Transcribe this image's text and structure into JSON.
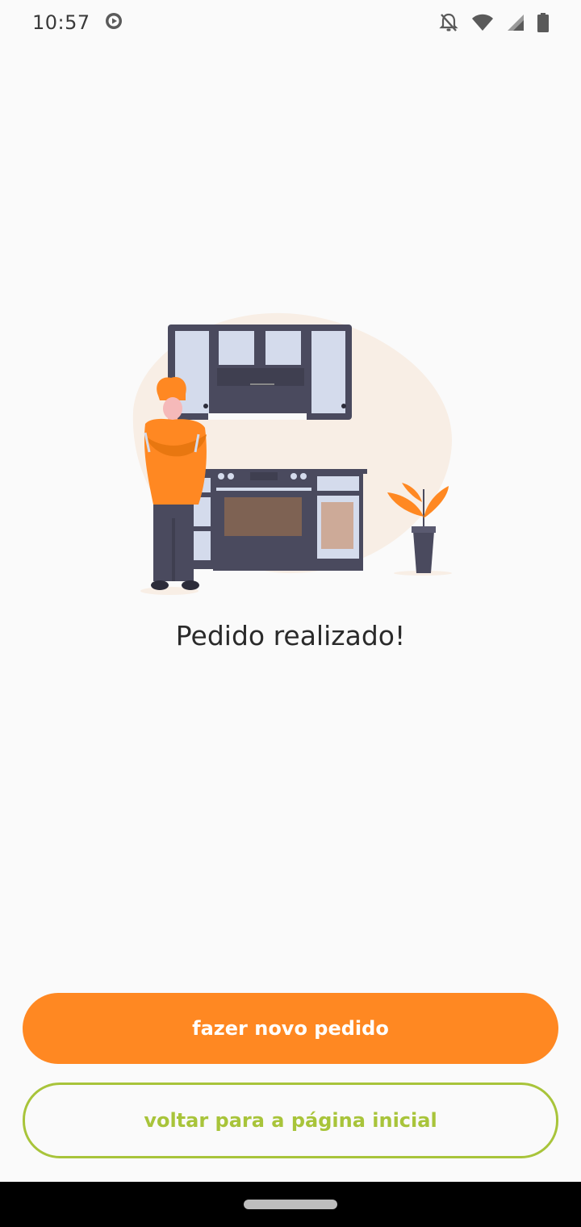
{
  "status_bar": {
    "time": "10:57",
    "icons": [
      "play-circle-icon",
      "bell-off-icon",
      "wifi-icon",
      "signal-icon",
      "battery-icon"
    ]
  },
  "illustration": {
    "description_icon": "chef-kitchen-illustration",
    "colors": {
      "accent": "#ff8822",
      "dark": "#4a4a5e",
      "light_panel": "#d4dbec",
      "blob": "#f8eee5"
    }
  },
  "main": {
    "message": "Pedido realizado!"
  },
  "actions": {
    "primary_label": "fazer novo pedido",
    "secondary_label": "voltar para a página inicial"
  },
  "theme": {
    "primary": "#ff8822",
    "secondary": "#a8c43a"
  }
}
